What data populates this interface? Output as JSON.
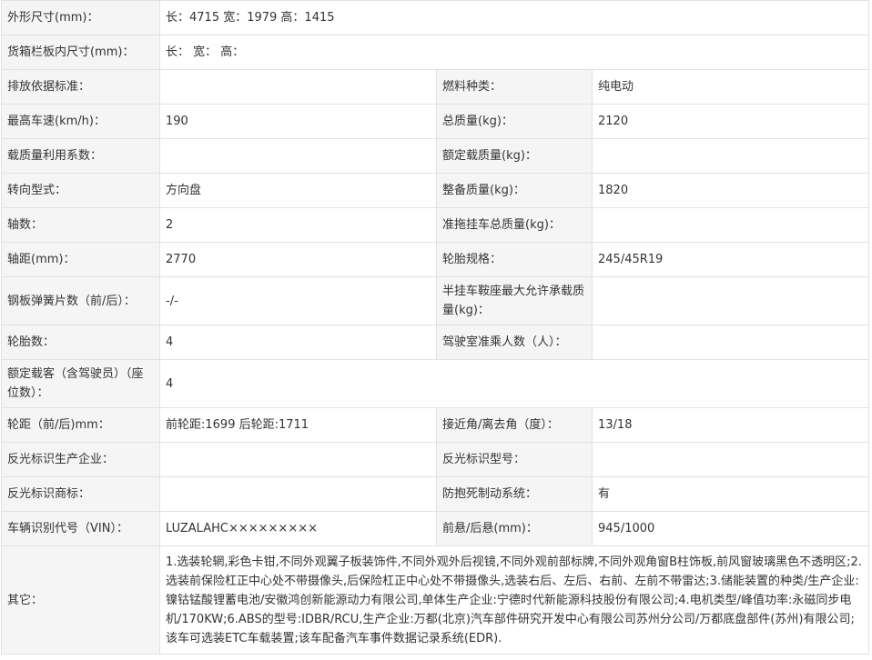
{
  "rows": [
    {
      "type": "span",
      "label": "外形尺寸(mm)：",
      "value": "长：4715 宽：1979 高：1415"
    },
    {
      "type": "span",
      "label": "货箱栏板内尺寸(mm)：",
      "value": "长： 宽： 高："
    },
    {
      "type": "pair",
      "l1": "排放依据标准：",
      "v1": "",
      "l2": "燃料种类：",
      "v2": "纯电动"
    },
    {
      "type": "pair",
      "l1": "最高车速(km/h)：",
      "v1": "190",
      "l2": "总质量(kg)：",
      "v2": "2120"
    },
    {
      "type": "pair",
      "l1": "载质量利用系数：",
      "v1": "",
      "l2": "额定载质量(kg)：",
      "v2": ""
    },
    {
      "type": "pair",
      "l1": "转向型式：",
      "v1": "方向盘",
      "l2": "整备质量(kg)：",
      "v2": "1820"
    },
    {
      "type": "pair",
      "l1": "轴数：",
      "v1": "2",
      "l2": "准拖挂车总质量(kg)：",
      "v2": ""
    },
    {
      "type": "pair",
      "l1": "轴距(mm)：",
      "v1": "2770",
      "l2": "轮胎规格：",
      "v2": "245/45R19"
    },
    {
      "type": "pair",
      "l1": "钢板弹簧片数（前/后）：",
      "v1": "-/-",
      "l2": "半挂车鞍座最大允许承载质量(kg)：",
      "v2": ""
    },
    {
      "type": "pair",
      "l1": "轮胎数：",
      "v1": "4",
      "l2": "驾驶室准乘人数（人）：",
      "v2": ""
    },
    {
      "type": "span",
      "label": "额定载客（含驾驶员）（座位数）：",
      "value": "4"
    },
    {
      "type": "pair",
      "l1": "轮距（前/后)mm：",
      "v1": "前轮距:1699 后轮距:1711",
      "l2": "接近角/离去角（度）：",
      "v2": "13/18"
    },
    {
      "type": "pair",
      "l1": "反光标识生产企业：",
      "v1": "",
      "l2": "反光标识型号：",
      "v2": ""
    },
    {
      "type": "pair",
      "l1": "反光标识商标：",
      "v1": "",
      "l2": "防抱死制动系统：",
      "v2": "有"
    },
    {
      "type": "pair",
      "l1": "车辆识别代号（VIN）：",
      "v1": "LUZALAHC×××××××××",
      "l2": "前悬/后悬(mm)：",
      "v2": "945/1000"
    }
  ],
  "other": {
    "label": "其它：",
    "value": "1.选装轮辋,彩色卡钳,不同外观翼子板装饰件,不同外观外后视镜,不同外观前部标牌,不同外观角窗B柱饰板,前风窗玻璃黑色不透明区;2.选装前保险杠正中心处不带摄像头,后保险杠正中心处不带摄像头,选装右后、左后、右前、左前不带雷达;3.储能装置的种类/生产企业:镍钴锰酸锂蓄电池/安徽鸿创新能源动力有限公司,单体生产企业:宁德时代新能源科技股份有限公司;4.电机类型/峰值功率:永磁同步电机/170KW;6.ABS的型号:IDBR/RCU,生产企业:万都(北京)汽车部件研究开发中心有限公司苏州分公司/万都底盘部件(苏州)有限公司;该车可选装ETC车载装置;该车配备汽车事件数据记录系统(EDR)."
  }
}
